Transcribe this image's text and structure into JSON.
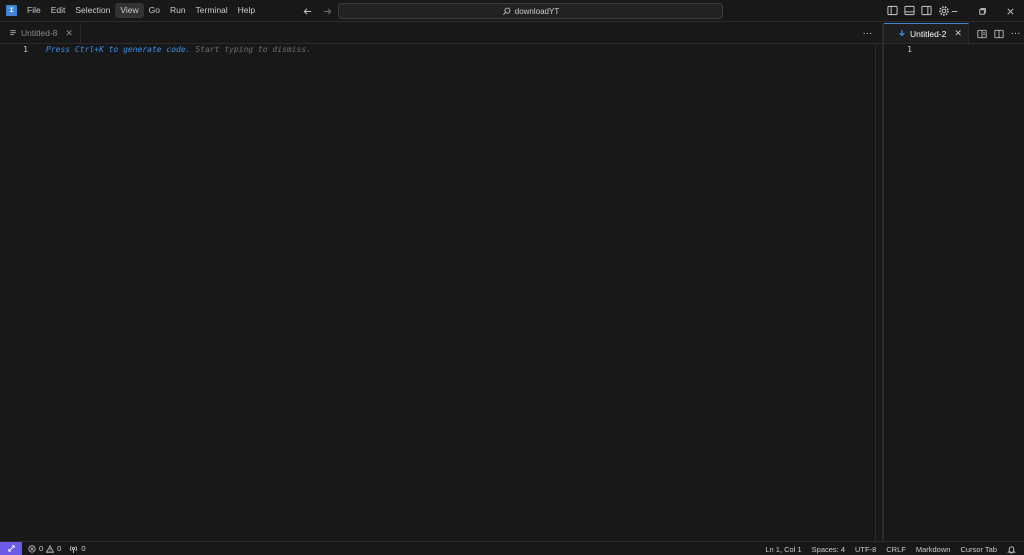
{
  "app": {
    "logo_glyph": "⌶",
    "accent_color": "#3f86d6"
  },
  "menu": [
    "File",
    "Edit",
    "Selection",
    "View",
    "Go",
    "Run",
    "Terminal",
    "Help"
  ],
  "menu_active": "View",
  "command_center": {
    "text": "downloadYT"
  },
  "editor_left": {
    "tab": {
      "label": "Untitled-8"
    },
    "line_numbers": [
      "1"
    ],
    "hint": {
      "highlight": "Press Ctrl+K to generate code.",
      "dim": " Start typing to dismiss."
    },
    "more_actions_label": "···"
  },
  "editor_right": {
    "tab": {
      "label": "Untitled-2"
    },
    "line_numbers": [
      "1"
    ],
    "more_actions_label": "···"
  },
  "statusbar": {
    "errors": "0",
    "warnings": "0",
    "ports": "0",
    "position": "Ln 1, Col 1",
    "spaces": "Spaces: 4",
    "encoding": "UTF-8",
    "eol": "CRLF",
    "language": "Markdown",
    "cursor_tab": "Cursor Tab",
    "remote_color": "#6c5ce7"
  }
}
